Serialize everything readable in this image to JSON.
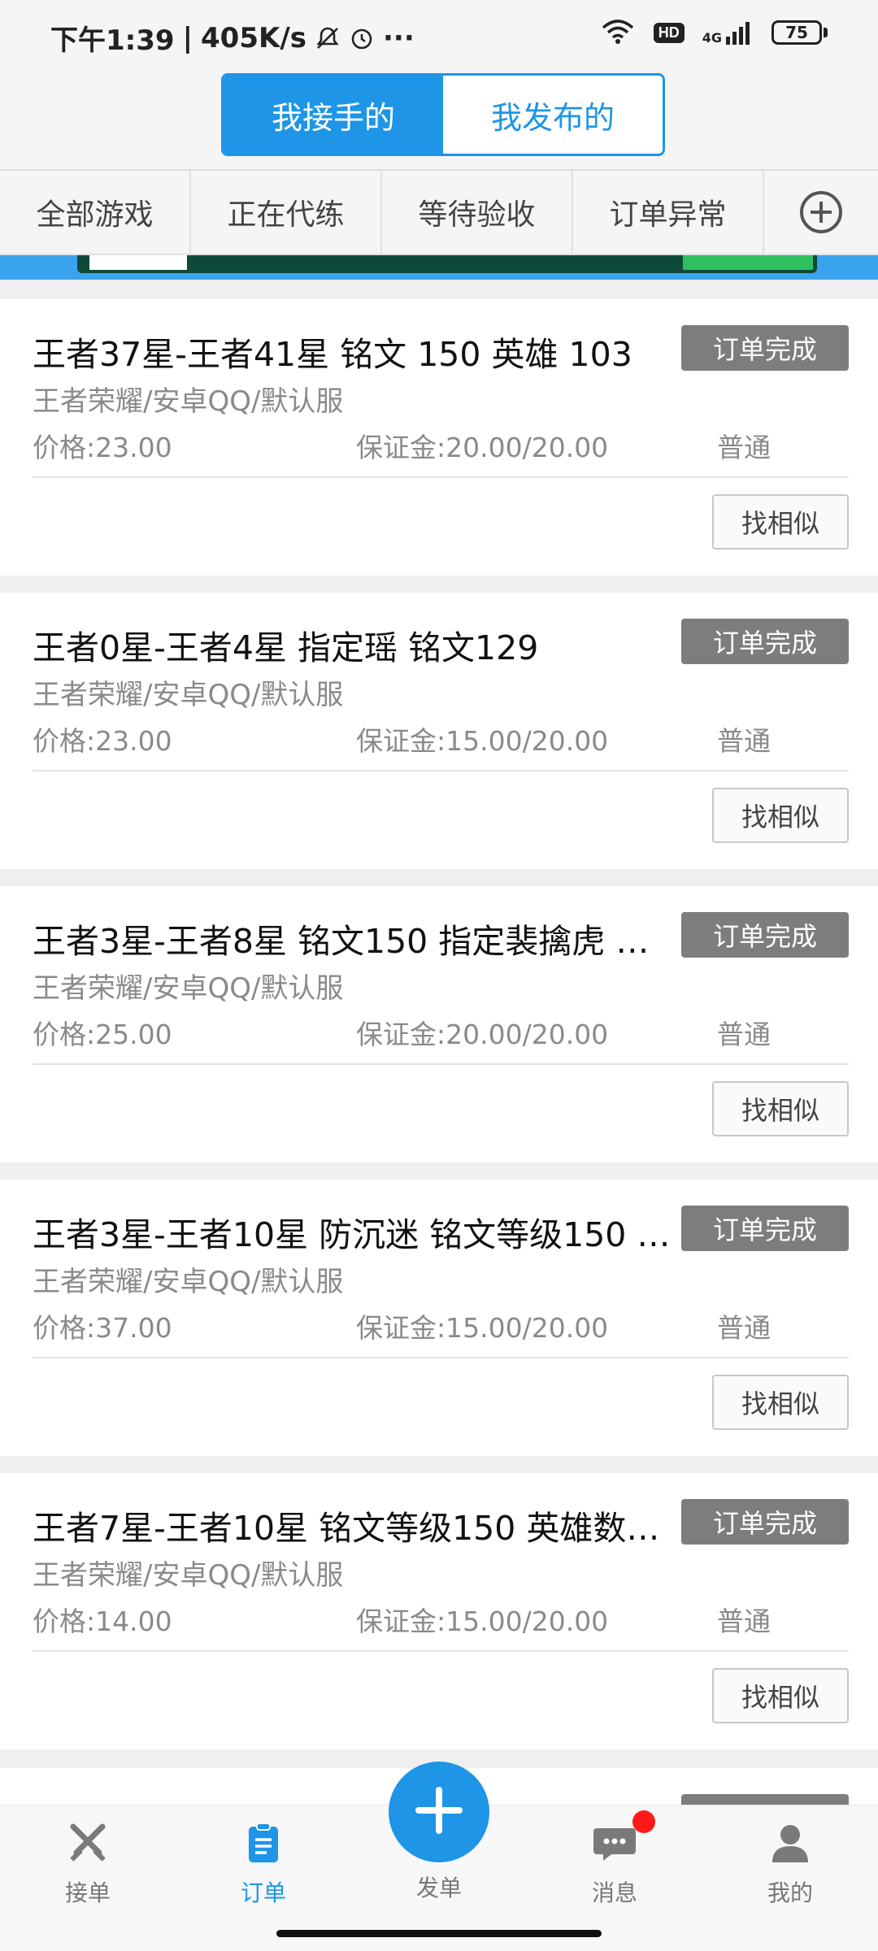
{
  "status_bar": {
    "time": "下午1:39",
    "speed": "405K/s",
    "hd": "HD",
    "network": "4G",
    "battery": "75"
  },
  "header": {
    "segments": [
      "我接手的",
      "我发布的"
    ],
    "active_segment": "我接手的",
    "accent_color": "#1e95e6"
  },
  "filter_tabs": {
    "items": [
      "全部游戏",
      "正在代练",
      "等待验收",
      "订单异常"
    ],
    "add_icon": "plus-circle-icon"
  },
  "orders": [
    {
      "title": "王者37星-王者41星 铭文 150 英雄 103",
      "status": "订单完成",
      "subtitle": "王者荣耀/安卓QQ/默认服",
      "price": "价格:23.00",
      "deposit": "保证金:20.00/20.00",
      "type": "普通",
      "action": "找相似"
    },
    {
      "title": "王者0星-王者4星 指定瑶 铭文129",
      "status": "订单完成",
      "subtitle": "王者荣耀/安卓QQ/默认服",
      "price": "价格:23.00",
      "deposit": "保证金:15.00/20.00",
      "type": "普通",
      "action": "找相似"
    },
    {
      "title": "王者3星-王者8星 铭文150 指定裴擒虎 …",
      "status": "订单完成",
      "subtitle": "王者荣耀/安卓QQ/默认服",
      "price": "价格:25.00",
      "deposit": "保证金:20.00/20.00",
      "type": "普通",
      "action": "找相似"
    },
    {
      "title": "王者3星-王者10星 防沉迷 铭文等级150 …",
      "status": "订单完成",
      "subtitle": "王者荣耀/安卓QQ/默认服",
      "price": "价格:37.00",
      "deposit": "保证金:15.00/20.00",
      "type": "普通",
      "action": "找相似"
    },
    {
      "title": "王者7星-王者10星 铭文等级150 英雄数…",
      "status": "订单完成",
      "subtitle": "王者荣耀/安卓QQ/默认服",
      "price": "价格:14.00",
      "deposit": "保证金:15.00/20.00",
      "type": "普通",
      "action": "找相似"
    }
  ],
  "bottom_nav": {
    "items": [
      {
        "label": "接单",
        "icon": "swords-icon"
      },
      {
        "label": "订单",
        "icon": "clipboard-icon",
        "active": true
      },
      {
        "label": "发单",
        "icon": "plus-icon"
      },
      {
        "label": "消息",
        "icon": "chat-icon",
        "badge": true
      },
      {
        "label": "我的",
        "icon": "person-icon"
      }
    ]
  }
}
